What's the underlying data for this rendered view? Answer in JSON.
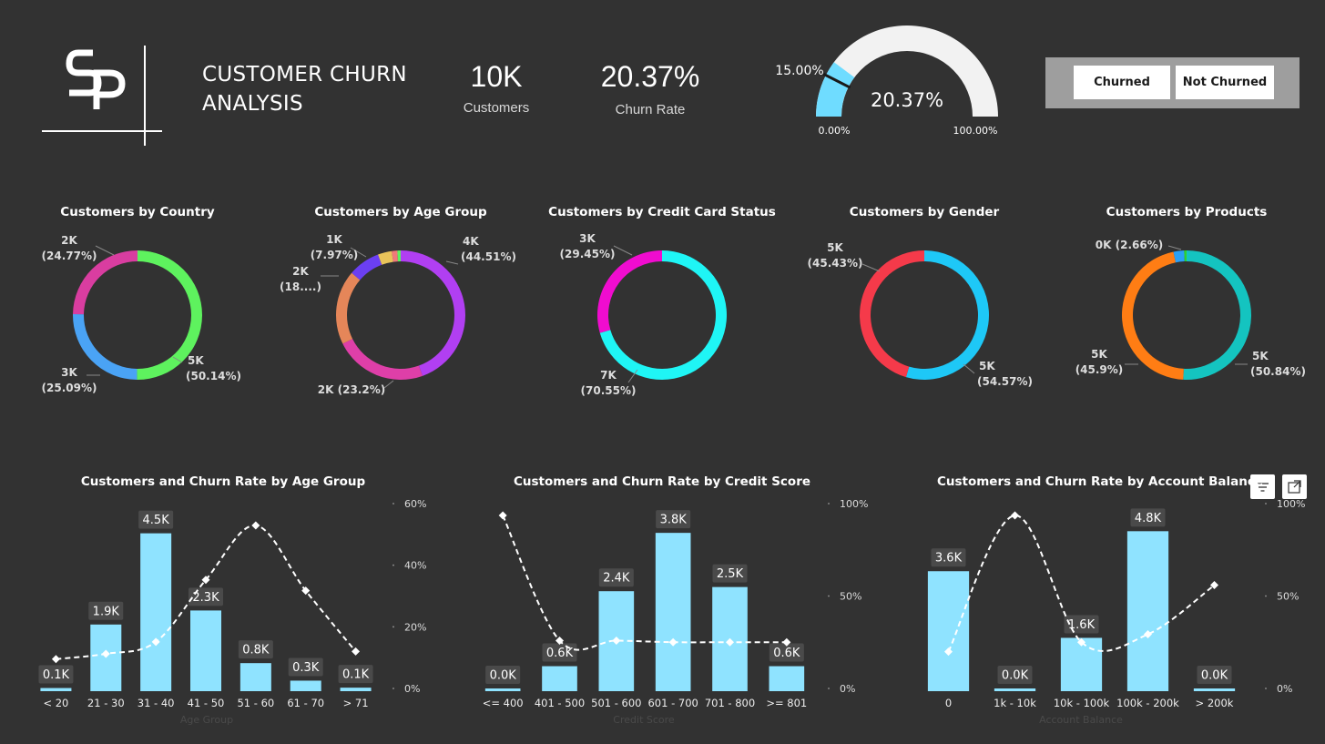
{
  "header": {
    "title_line1": "CUSTOMER CHURN",
    "title_line2": "ANALYSIS",
    "kpi_customers_value": "10K",
    "kpi_customers_label": "Customers",
    "kpi_churn_value": "20.37%",
    "kpi_churn_label": "Churn Rate"
  },
  "gauge": {
    "value": 20.37,
    "value_label": "20.37%",
    "target": 15.0,
    "target_label": "15.00%",
    "min_label": "0.00%",
    "max_label": "100.00%",
    "fill_color": "#6fdcff",
    "track_color": "#f2f2f2"
  },
  "slicer": {
    "option1": "Churned",
    "option2": "Not Churned"
  },
  "colors": {
    "background": "#323232",
    "bar": "#8fe3ff",
    "label_bg": "#4a4a4a"
  },
  "chart_data": [
    {
      "type": "pie",
      "title": "Customers by Country",
      "slices": [
        {
          "value": 50.14,
          "color": "#5ef25e",
          "label": "5K",
          "pct": "(50.14%)"
        },
        {
          "value": 25.09,
          "color": "#4aa3f5",
          "label": "3K",
          "pct": "(25.09%)"
        },
        {
          "value": 24.77,
          "color": "#d93da0",
          "label": "2K",
          "pct": "(24.77%)"
        }
      ]
    },
    {
      "type": "pie",
      "title": "Customers by Age Group",
      "slices": [
        {
          "value": 44.51,
          "color": "#b13ff2",
          "label": "4K",
          "pct": "(44.51%)"
        },
        {
          "value": 23.2,
          "color": "#de3fa8",
          "label": "2K (23.2%)",
          "pct": ""
        },
        {
          "value": 18.6,
          "color": "#e58659",
          "label": "2K",
          "pct": "(18....)"
        },
        {
          "value": 7.97,
          "color": "#6b3ff2",
          "label": "1K",
          "pct": "(7.97%)"
        },
        {
          "value": 3.5,
          "color": "#e8c35a",
          "label": "",
          "pct": ""
        },
        {
          "value": 1.4,
          "color": "#f07a7a",
          "label": "",
          "pct": ""
        },
        {
          "value": 0.82,
          "color": "#5ef25e",
          "label": "",
          "pct": ""
        }
      ]
    },
    {
      "type": "pie",
      "title": "Customers by Credit Card Status",
      "slices": [
        {
          "value": 70.55,
          "color": "#1ff5f5",
          "label": "7K",
          "pct": "(70.55%)"
        },
        {
          "value": 29.45,
          "color": "#f00ccf",
          "label": "3K",
          "pct": "(29.45%)"
        }
      ]
    },
    {
      "type": "pie",
      "title": "Customers by Gender",
      "slices": [
        {
          "value": 54.57,
          "color": "#1ec8f7",
          "label": "5K",
          "pct": "(54.57%)"
        },
        {
          "value": 45.43,
          "color": "#f53a4a",
          "label": "5K",
          "pct": "(45.43%)"
        }
      ]
    },
    {
      "type": "pie",
      "title": "Customers by Products",
      "slices": [
        {
          "value": 50.84,
          "color": "#14c4c0",
          "label": "5K",
          "pct": "(50.84%)"
        },
        {
          "value": 45.9,
          "color": "#ff7d14",
          "label": "5K",
          "pct": "(45.9%)"
        },
        {
          "value": 2.66,
          "color": "#2aa0f5",
          "label": "0K (2.66%)",
          "pct": ""
        },
        {
          "value": 0.6,
          "color": "#2fd12f",
          "label": "",
          "pct": ""
        }
      ]
    },
    {
      "type": "bar",
      "title": "Customers and Churn Rate by Age Group",
      "xlabel": "Age Group",
      "categories": [
        "< 20",
        "21 - 30",
        "31 - 40",
        "41 - 50",
        "51 - 60",
        "61 - 70",
        "> 71"
      ],
      "values": [
        0.09,
        1.9,
        4.5,
        2.3,
        0.8,
        0.3,
        0.1
      ],
      "labels": [
        "0.1K",
        "1.9K",
        "4.5K",
        "2.3K",
        "0.8K",
        "0.3K",
        "0.1K"
      ],
      "line_values": [
        5.6,
        7.6,
        12.1,
        35.6,
        56.2,
        31.5,
        8.5
      ],
      "y2_ticks": [
        "0%",
        "20%",
        "40%",
        "60%"
      ],
      "y2_max": 60,
      "y_max": 4.75
    },
    {
      "type": "bar",
      "title": "Customers and Churn Rate by Credit Score",
      "xlabel": "Credit Score",
      "categories": [
        "<= 400",
        "401 - 500",
        "501 - 600",
        "601 - 700",
        "701 - 800",
        ">= 801"
      ],
      "values": [
        0.02,
        0.6,
        2.4,
        3.8,
        2.5,
        0.6
      ],
      "labels": [
        "0.0K",
        "0.6K",
        "2.4K",
        "3.8K",
        "2.5K",
        "0.6K"
      ],
      "line_values": [
        100,
        21,
        21,
        20,
        20,
        20
      ],
      "y2_ticks": [
        "0%",
        "50%",
        "100%"
      ],
      "y2_max": 100,
      "y_max": 4.0
    },
    {
      "type": "bar",
      "title": "Customers and Churn Rate by Account Balance",
      "xlabel": "Account Balance",
      "categories": [
        "0",
        "1k - 10k",
        "10k - 100k",
        "100k - 200k",
        "> 200k"
      ],
      "values": [
        3.6,
        0.01,
        1.6,
        4.8,
        0.01
      ],
      "labels": [
        "3.6K",
        "0.0K",
        "1.6K",
        "4.8K",
        "0.0K"
      ],
      "line_values": [
        14,
        100,
        20,
        25,
        56
      ],
      "y2_ticks": [
        "0%",
        "50%",
        "100%"
      ],
      "y2_max": 100,
      "y_max": 5.0
    }
  ]
}
